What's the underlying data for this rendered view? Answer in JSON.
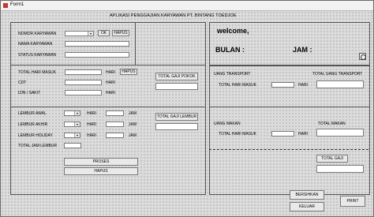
{
  "window": {
    "title": "Form1"
  },
  "app_title": "APLIKASI PENGGAJIAN KARYAWAN PT. BINTANG TOEDJOE",
  "employee": {
    "nomor_label": "NOMOR KARYAWAN",
    "nama_label": "NAMA KARYAWAN",
    "status_label": "STATUS KARYAWAN",
    "ok_label": "OK",
    "hapus_label": "HAPUS"
  },
  "attendance": {
    "hari_masuk_label": "TOTAL HARI MASUK",
    "cdt_label": "CDT",
    "izin_label": "IZIN / SAKIT",
    "hari_unit": "HARI",
    "hapus_label": "HAPUS",
    "total_gaji_pokok_label": "TOTAL GAJI POKOK"
  },
  "overtime": {
    "awal_label": "LEMBUR AWAL",
    "akhir_label": "LEMBUR AKHIR",
    "holiday_label": "LEMBUR HOLIDAY",
    "total_jam_label": "TOTAL JAM LEMBUR",
    "hari_unit": "HARI",
    "jam_unit": "JAM",
    "total_gaji_lembur_label": "TOTAL GAJI LEMBUR"
  },
  "actions": {
    "proses_label": "PROSES",
    "hapus_label": "HAPUS"
  },
  "welcome": {
    "welcome_text": "welcome,",
    "bulan_label": "BULAN :",
    "jam_label": "JAM :"
  },
  "transport": {
    "title": "UANG TRANSPORT",
    "total_label": "TOTAL UANG TRANSPORT",
    "hari_masuk_label": "TOTAL HARI MASUK",
    "hari_unit": "HARI"
  },
  "meal": {
    "title": "UANG MAKAN",
    "total_label": "TOTAL MAKAN",
    "hari_masuk_label": "TOTAL HARI MASUK",
    "hari_unit": "HARI"
  },
  "salary": {
    "total_gaji_label": "TOTAL GAJI"
  },
  "footer": {
    "bersihkan_label": "BERSIHKAN",
    "keluar_label": "KELUAR",
    "print_label": "PRINT"
  },
  "icons": {
    "window_icon": "app-icon",
    "clock_icon": "clock-icon"
  }
}
